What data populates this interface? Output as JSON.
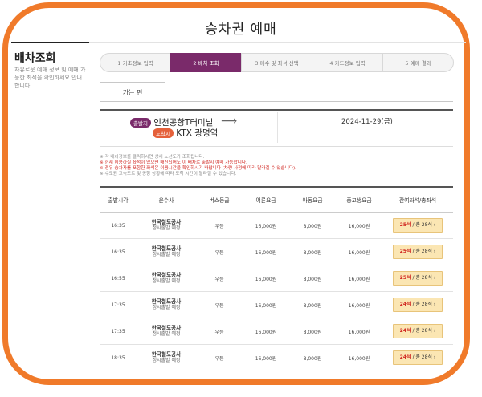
{
  "header": {
    "title": "승차권 예매"
  },
  "sidebar": {
    "title": "배차조회",
    "description": "자유로운 예매 정보 및 예매 가능한 좌석을 확인하세요 안내 합니다."
  },
  "steps": [
    {
      "label": "1 기초정보 입력",
      "active": false
    },
    {
      "label": "2 배차 조회",
      "active": true
    },
    {
      "label": "3 매수 및 좌석 선택",
      "active": false
    },
    {
      "label": "4 카드정보 입력",
      "active": false
    },
    {
      "label": "5 예매 결과",
      "active": false
    }
  ],
  "tab": {
    "label": "가는 편"
  },
  "route": {
    "departure_badge": "출발지",
    "departure": "인천공항T터미널",
    "arrival_badge": "도착지",
    "arrival": "KTX 광명역",
    "date": "2024-11-29(금)"
  },
  "notes": [
    {
      "text": "※ 각 배차정보를 클릭하시면 상세 노선도가 조회됩니다.",
      "red": false
    },
    {
      "text": "※ 현재 이용하실 좌석이 있으면 매진되어도 이 배차로 출발시 예매 가능합니다.",
      "red": true
    },
    {
      "text": "※ 경유 승차자를 포함한 좌석은 이용시간을 확인하시기 바랍니다 (차량 사정에 따라 달라질 수 있습니다).",
      "red": true
    },
    {
      "text": "※ 수도권 고속도로 및 공항 상황에 따라 도착 시간이 달라질 수 있습니다.",
      "red": false
    }
  ],
  "table": {
    "headers": [
      "출발시각",
      "운수사",
      "버스등급",
      "어른요금",
      "아동요금",
      "중고생요금",
      "잔여좌석/총좌석"
    ],
    "rows": [
      {
        "time": "16:35",
        "company": "한국철도공사",
        "note": "정시출발 예정",
        "grade": "우등",
        "adult": "16,000원",
        "child": "8,000원",
        "youth": "16,000원",
        "remaining": "25석",
        "total": "/ 총 28석"
      },
      {
        "time": "16:35",
        "company": "한국철도공사",
        "note": "정시출발 예정",
        "grade": "우등",
        "adult": "16,000원",
        "child": "8,000원",
        "youth": "16,000원",
        "remaining": "25석",
        "total": "/ 총 28석"
      },
      {
        "time": "16:55",
        "company": "한국철도공사",
        "note": "정시출발 예정",
        "grade": "우등",
        "adult": "16,000원",
        "child": "8,000원",
        "youth": "16,000원",
        "remaining": "25석",
        "total": "/ 총 28석"
      },
      {
        "time": "17:35",
        "company": "한국철도공사",
        "note": "정시출발 예정",
        "grade": "우등",
        "adult": "16,000원",
        "child": "8,000원",
        "youth": "16,000원",
        "remaining": "24석",
        "total": "/ 총 28석"
      },
      {
        "time": "17:35",
        "company": "한국철도공사",
        "note": "정시출발 예정",
        "grade": "우등",
        "adult": "16,000원",
        "child": "8,000원",
        "youth": "16,000원",
        "remaining": "24석",
        "total": "/ 총 28석"
      },
      {
        "time": "18:35",
        "company": "한국철도공사",
        "note": "정시출발 예정",
        "grade": "우등",
        "adult": "16,000원",
        "child": "8,000원",
        "youth": "16,000원",
        "remaining": "24석",
        "total": "/ 총 28석"
      }
    ]
  },
  "colors": {
    "frame": "#f07a2a",
    "accent": "#7a2a6a",
    "arrival": "#e5603a",
    "seat_button": "#fbe6b3",
    "available": "#d0241f"
  }
}
